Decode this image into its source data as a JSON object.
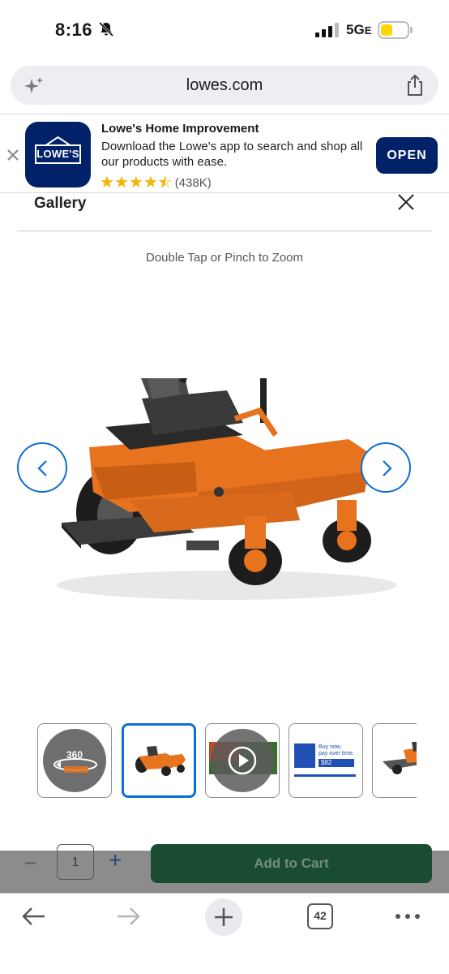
{
  "status_bar": {
    "time": "8:16",
    "network": "5G",
    "network_suffix": "E",
    "battery_color": "#ffd60a"
  },
  "address_bar": {
    "url": "lowes.com"
  },
  "app_banner": {
    "app_name": "Lowe's Home Improvement",
    "description": "Download the Lowe's app to search and shop all our products with ease.",
    "rating_stars": 4.5,
    "rating_count": "(438K)",
    "open_label": "OPEN",
    "logo_text": "LOWE'S",
    "brand_color": "#012169"
  },
  "gallery": {
    "title": "Gallery",
    "zoom_hint": "Double Tap or Pinch to Zoom",
    "accent_color": "#0b6fd3",
    "thumbnails": [
      {
        "kind": "360",
        "label": "360"
      },
      {
        "kind": "image",
        "active": true
      },
      {
        "kind": "video"
      },
      {
        "kind": "image",
        "text_line1": "Buy now,",
        "text_line2": "pay over time.",
        "amount": "$82"
      },
      {
        "kind": "image"
      }
    ]
  },
  "buy_bar": {
    "quantity": "1",
    "minus": "−",
    "plus": "+",
    "add_to_cart": "Add to Cart"
  },
  "toolbar": {
    "tab_count": "42"
  }
}
